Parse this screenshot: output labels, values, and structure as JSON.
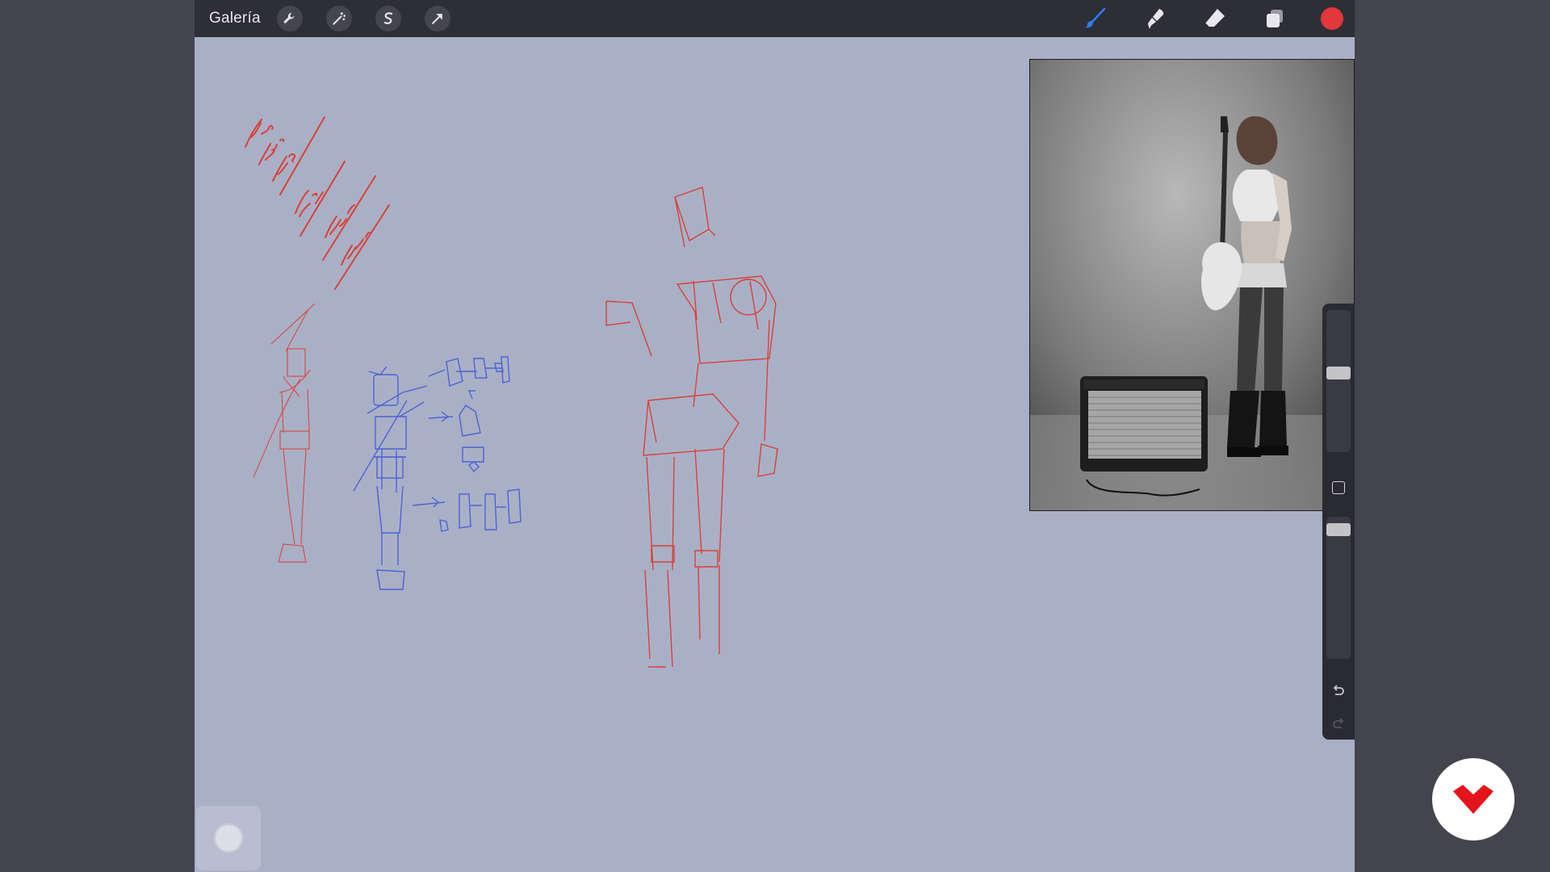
{
  "topbar": {
    "gallery_label": "Galería",
    "left_tools": [
      {
        "name": "actions",
        "icon": "wrench-icon"
      },
      {
        "name": "adjustments",
        "icon": "magic-wand-icon"
      },
      {
        "name": "selection",
        "icon": "selection-s-icon"
      },
      {
        "name": "transform",
        "icon": "transform-arrow-icon"
      }
    ],
    "right_tools": [
      {
        "name": "brush",
        "icon": "brush-icon",
        "active": true
      },
      {
        "name": "smudge",
        "icon": "smudge-icon"
      },
      {
        "name": "eraser",
        "icon": "eraser-icon"
      },
      {
        "name": "layers",
        "icon": "layers-icon"
      }
    ],
    "current_color": "#e2373b"
  },
  "sidebar": {
    "brush_size_level": 0.3,
    "opacity_level": 0.1
  },
  "colors": {
    "canvas": "#a9b0c6",
    "topbar": "#2e2e36",
    "sketch_red": "#d9403a",
    "sketch_blue": "#4c63d6",
    "accent_brush": "#2f7bf0"
  }
}
